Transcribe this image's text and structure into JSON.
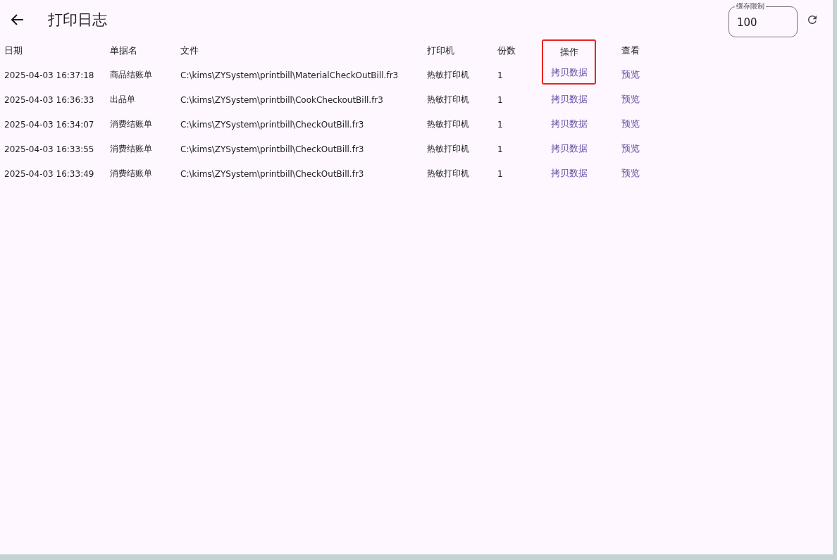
{
  "title": "打印日志",
  "cache_limit": {
    "label": "缓存限制",
    "value": "100"
  },
  "table": {
    "columns": [
      {
        "label": "日期",
        "highlighted": false
      },
      {
        "label": "单据名",
        "highlighted": false
      },
      {
        "label": "文件",
        "highlighted": false
      },
      {
        "label": "打印机",
        "highlighted": false
      },
      {
        "label": "份数",
        "highlighted": false
      },
      {
        "label": "操作",
        "highlighted": true
      },
      {
        "label": "查看",
        "highlighted": false
      }
    ],
    "rows": [
      {
        "date": "2025-04-03 16:37:18",
        "bill": "商品结账单",
        "file": "C:\\kims\\ZYSystem\\printbill\\MaterialCheckOutBill.fr3",
        "printer": "热敏打印机",
        "copies": "1",
        "action": "拷贝数据",
        "view": "预览",
        "highlighted": true
      },
      {
        "date": "2025-04-03 16:36:33",
        "bill": "出品单",
        "file": "C:\\kims\\ZYSystem\\printbill\\CookCheckoutBill.fr3",
        "printer": "热敏打印机",
        "copies": "1",
        "action": "拷贝数据",
        "view": "预览",
        "highlighted": false
      },
      {
        "date": "2025-04-03 16:34:07",
        "bill": "消费结账单",
        "file": "C:\\kims\\ZYSystem\\printbill\\CheckOutBill.fr3",
        "printer": "热敏打印机",
        "copies": "1",
        "action": "拷贝数据",
        "view": "预览",
        "highlighted": false
      },
      {
        "date": "2025-04-03 16:33:55",
        "bill": "消费结账单",
        "file": "C:\\kims\\ZYSystem\\printbill\\CheckOutBill.fr3",
        "printer": "热敏打印机",
        "copies": "1",
        "action": "拷贝数据",
        "view": "预览",
        "highlighted": false
      },
      {
        "date": "2025-04-03 16:33:49",
        "bill": "消费结账单",
        "file": "C:\\kims\\ZYSystem\\printbill\\CheckOutBill.fr3",
        "printer": "热敏打印机",
        "copies": "1",
        "action": "拷贝数据",
        "view": "预览",
        "highlighted": false
      }
    ]
  }
}
